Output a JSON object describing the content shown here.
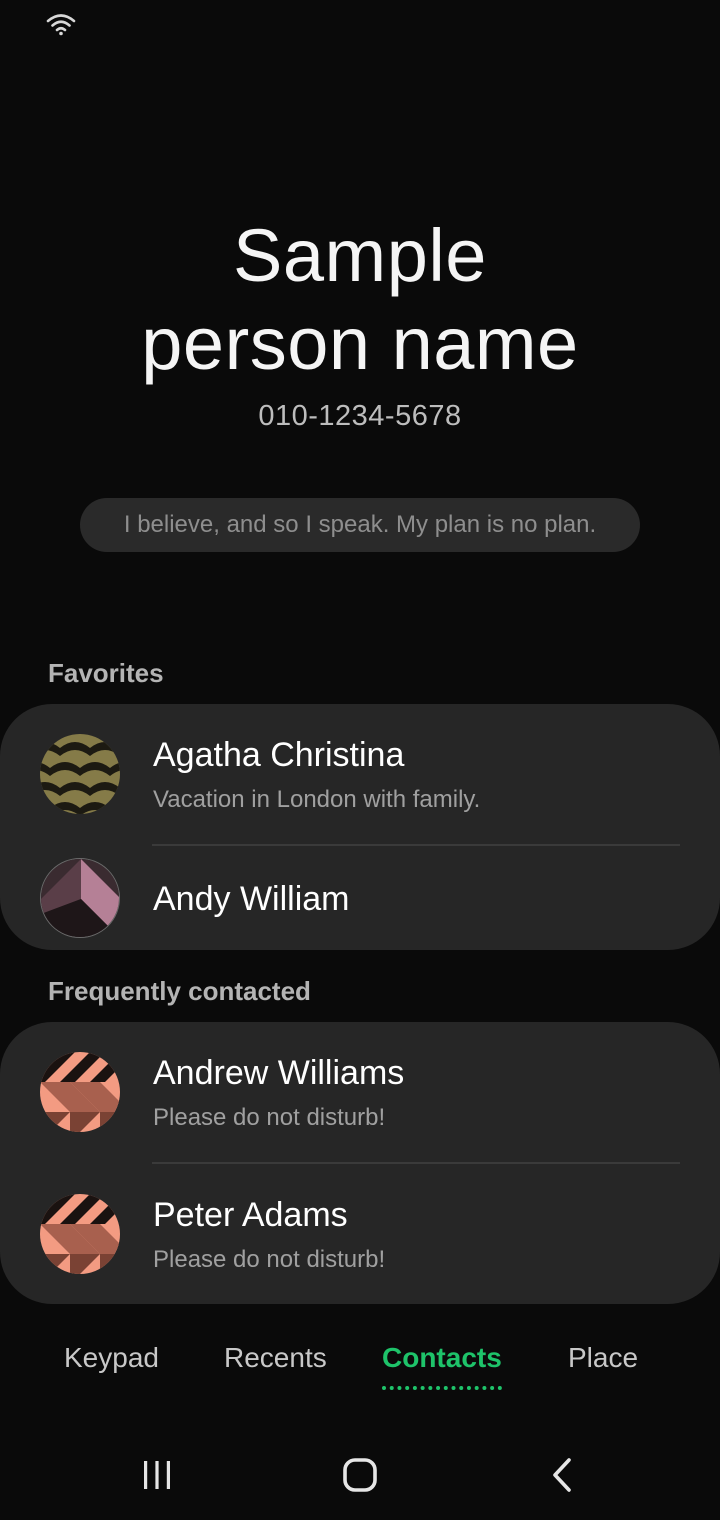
{
  "status_bar": {
    "wifi_icon": "wifi-icon"
  },
  "profile": {
    "name_line1": "Sample",
    "name_line2": "person name",
    "phone": "010-1234-5678",
    "status_message": "I believe, and so I speak. My plan is no plan."
  },
  "favorites": {
    "title": "Favorites",
    "contacts": [
      {
        "name": "Agatha Christina",
        "status": "Vacation in London with family."
      },
      {
        "name": "Andy William",
        "status": ""
      }
    ]
  },
  "frequent": {
    "title": "Frequently contacted",
    "contacts": [
      {
        "name": "Andrew Williams",
        "status": "Please do not disturb!"
      },
      {
        "name": "Peter Adams",
        "status": "Please do not disturb!"
      }
    ]
  },
  "tabs": [
    {
      "label": "Keypad"
    },
    {
      "label": "Recents"
    },
    {
      "label": "Contacts",
      "active": true
    },
    {
      "label": "Place"
    }
  ],
  "nav_bar": {
    "recents_icon": "recent-apps-icon",
    "home_icon": "home-icon",
    "back_icon": "back-icon"
  },
  "colors": {
    "background": "#0a0a0a",
    "card": "#262626",
    "accent": "#1ec36a"
  }
}
